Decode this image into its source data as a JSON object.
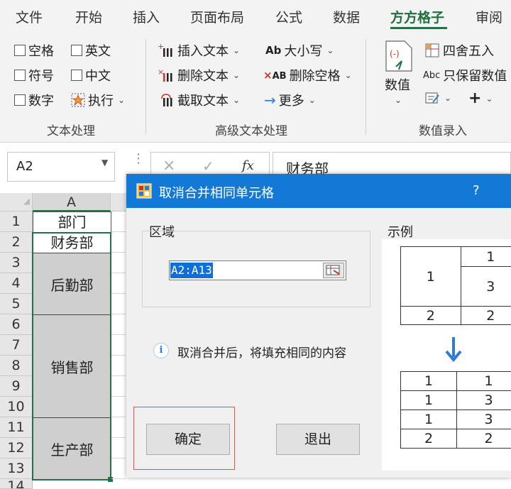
{
  "ribbon": {
    "tabs": [
      "文件",
      "开始",
      "插入",
      "页面布局",
      "公式",
      "数据",
      "方方格子",
      "审阅"
    ],
    "active_tab": "方方格子",
    "text_group": {
      "label": "文本处理",
      "items": [
        "空格",
        "英文",
        "符号",
        "中文",
        "数字",
        "执行"
      ]
    },
    "advanced_group": {
      "label": "高级文本处理",
      "insert_text": "插入文本",
      "delete_text": "删除文本",
      "extract_text": "截取文本",
      "case": "大小写",
      "case_icon": "Ab",
      "delete_space": "删除空格",
      "delete_space_icon": "AB",
      "more": "更多"
    },
    "number_group": {
      "label": "数值录入",
      "numeric": "数值",
      "round": "四舍五入",
      "keep_value": "只保留数值",
      "keep_value_icon": "Abc",
      "plus": "+"
    }
  },
  "formula_bar": {
    "name_box": "A2",
    "cancel_symbol": "×",
    "enter_symbol": "✓",
    "fx_symbol": "fx",
    "formula": "财务部"
  },
  "grid": {
    "column_a": "A",
    "rows": [
      "1",
      "2",
      "3",
      "4",
      "5",
      "6",
      "7",
      "8",
      "9",
      "10",
      "11",
      "12",
      "13",
      "14"
    ],
    "header_cell": "部门",
    "a2": "财务部",
    "merged": [
      "后勤部",
      "销售部",
      "生产部"
    ]
  },
  "dialog": {
    "title": "取消合并相同单元格",
    "help": "?",
    "region_label": "区域",
    "range_value": "A2:A13",
    "example_label": "示例",
    "info_text": "取消合并后，将填充相同的内容",
    "ok": "确定",
    "exit": "退出",
    "example_before": {
      "merged_1": "1",
      "r1": "1",
      "r2": "3",
      "left3": "2",
      "right3": "2"
    },
    "example_after": [
      [
        "1",
        "1"
      ],
      [
        "1",
        "3"
      ],
      [
        "1",
        "3"
      ],
      [
        "2",
        "2"
      ]
    ]
  },
  "colors": {
    "accent_green": "#217346",
    "dialog_title_blue": "#1379d7",
    "arrow_blue": "#2e7cd6",
    "highlight_red": "#e05050"
  }
}
